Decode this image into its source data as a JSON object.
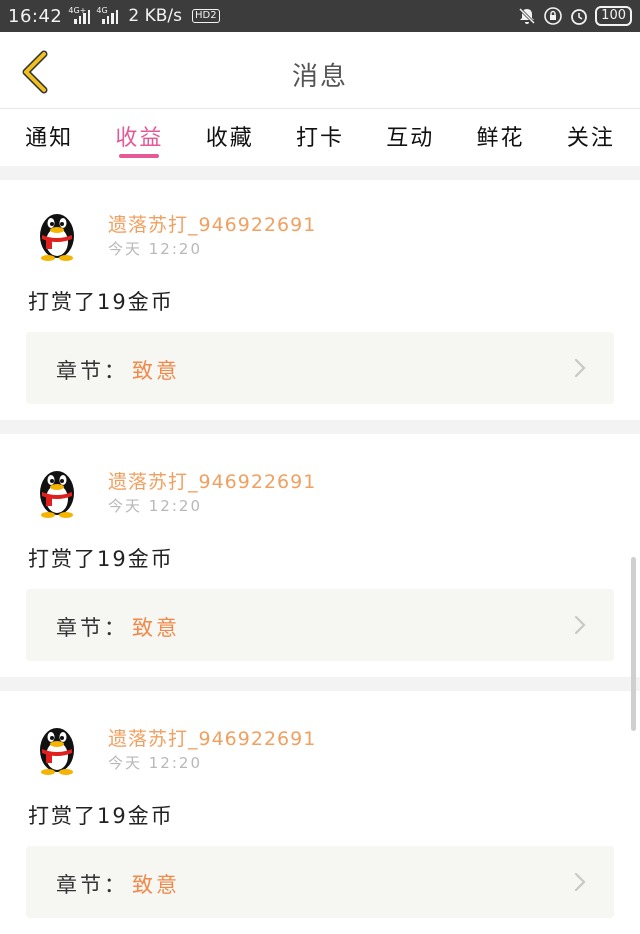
{
  "status_bar": {
    "time": "16:42",
    "signal1_tag": "4G+",
    "signal2_tag": "4G",
    "speed": "2 KB/s",
    "hd_badge": "HD2",
    "battery": "100",
    "icons": [
      "mute-icon",
      "lock-rotation-icon",
      "alarm-icon"
    ]
  },
  "header": {
    "title": "消息",
    "back_icon": "chevron-left-icon",
    "accent_color": "#f0c020"
  },
  "tabs": [
    {
      "label": "通知",
      "active": false
    },
    {
      "label": "收益",
      "active": true
    },
    {
      "label": "收藏",
      "active": false
    },
    {
      "label": "打卡",
      "active": false
    },
    {
      "label": "互动",
      "active": false
    },
    {
      "label": "鲜花",
      "active": false
    },
    {
      "label": "关注",
      "active": false
    }
  ],
  "tab_active_color": "#e55a96",
  "messages": [
    {
      "username": "遗落苏打_946922691",
      "time": "今天 12:20",
      "body": "打赏了19金币",
      "chapter_label": "章节：",
      "chapter_name": "致意",
      "avatar_icon": "qq-penguin-icon"
    },
    {
      "username": "遗落苏打_946922691",
      "time": "今天 12:20",
      "body": "打赏了19金币",
      "chapter_label": "章节：",
      "chapter_name": "致意",
      "avatar_icon": "qq-penguin-icon"
    },
    {
      "username": "遗落苏打_946922691",
      "time": "今天 12:20",
      "body": "打赏了19金币",
      "chapter_label": "章节：",
      "chapter_name": "致意",
      "avatar_icon": "qq-penguin-icon"
    }
  ]
}
